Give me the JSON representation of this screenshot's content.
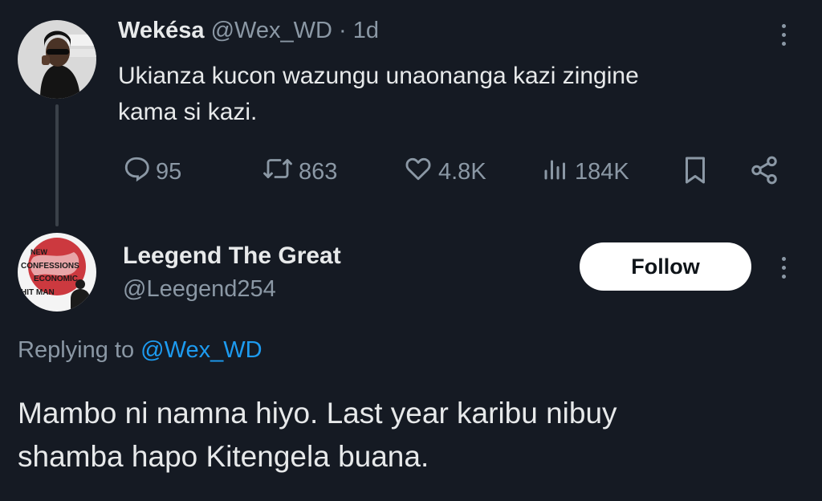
{
  "tweet": {
    "author_name": "Wekésa",
    "handle": "@Wex_WD",
    "separator": "·",
    "time": "1d",
    "text_line1": "Ukianza kucon wazungu unaonanga kazi zingine",
    "text_line2": "kama si kazi.",
    "actions": {
      "replies": "95",
      "retweets": "863",
      "likes": "4.8K",
      "views": "184K"
    }
  },
  "reply": {
    "author_name": "Leegend The Great",
    "handle": "@Leegend254",
    "follow_label": "Follow",
    "replying_prefix": "Replying to",
    "replying_handle": "@Wex_WD",
    "text_line1": "Mambo ni namna hiyo. Last year karibu nibuy",
    "text_line2": "shamba hapo Kitengela buana."
  },
  "avatar2_text": {
    "line1": "NEW",
    "line2": "CONFESSIONS",
    "line3": "ECONOMIC",
    "line4": "HIT MAN"
  },
  "colors": {
    "background": "#151a23",
    "text": "#e7e9ea",
    "muted": "#8b98a5",
    "link": "#1d9bf0",
    "follow_bg": "#ffffff"
  },
  "icons": [
    "more-icon",
    "reply-icon",
    "retweet-icon",
    "like-icon",
    "views-icon",
    "bookmark-icon",
    "share-icon"
  ]
}
